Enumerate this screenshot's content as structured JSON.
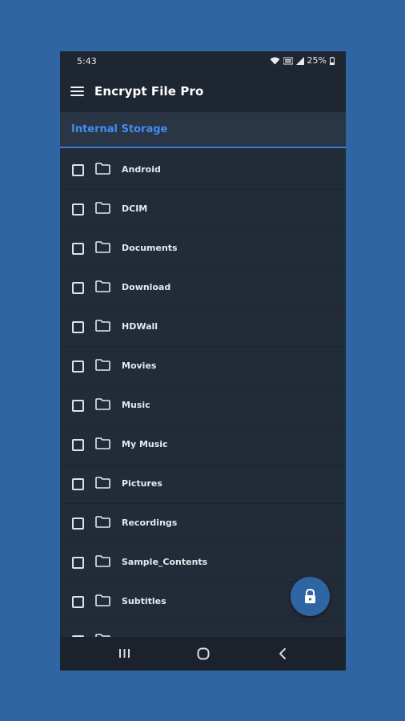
{
  "status_bar": {
    "time": "5:43",
    "battery": "25%"
  },
  "app_bar": {
    "title": "Encrypt File Pro"
  },
  "location": {
    "label": "Internal Storage"
  },
  "folders": [
    {
      "label": "Android"
    },
    {
      "label": "DCIM"
    },
    {
      "label": "Documents"
    },
    {
      "label": "Download"
    },
    {
      "label": "HDWall"
    },
    {
      "label": "Movies"
    },
    {
      "label": "Music"
    },
    {
      "label": "My Music"
    },
    {
      "label": "Pictures"
    },
    {
      "label": "Recordings"
    },
    {
      "label": "Sample_Contents"
    },
    {
      "label": "Subtitles"
    },
    {
      "label": ""
    }
  ],
  "fab": {
    "icon": "lock-icon"
  },
  "nav_bar": {
    "icons": [
      "recent-apps-icon",
      "home-icon",
      "back-icon"
    ]
  },
  "colors": {
    "background": "#2f65a3",
    "accent": "#3f8ef0",
    "surface": "#222b38"
  }
}
